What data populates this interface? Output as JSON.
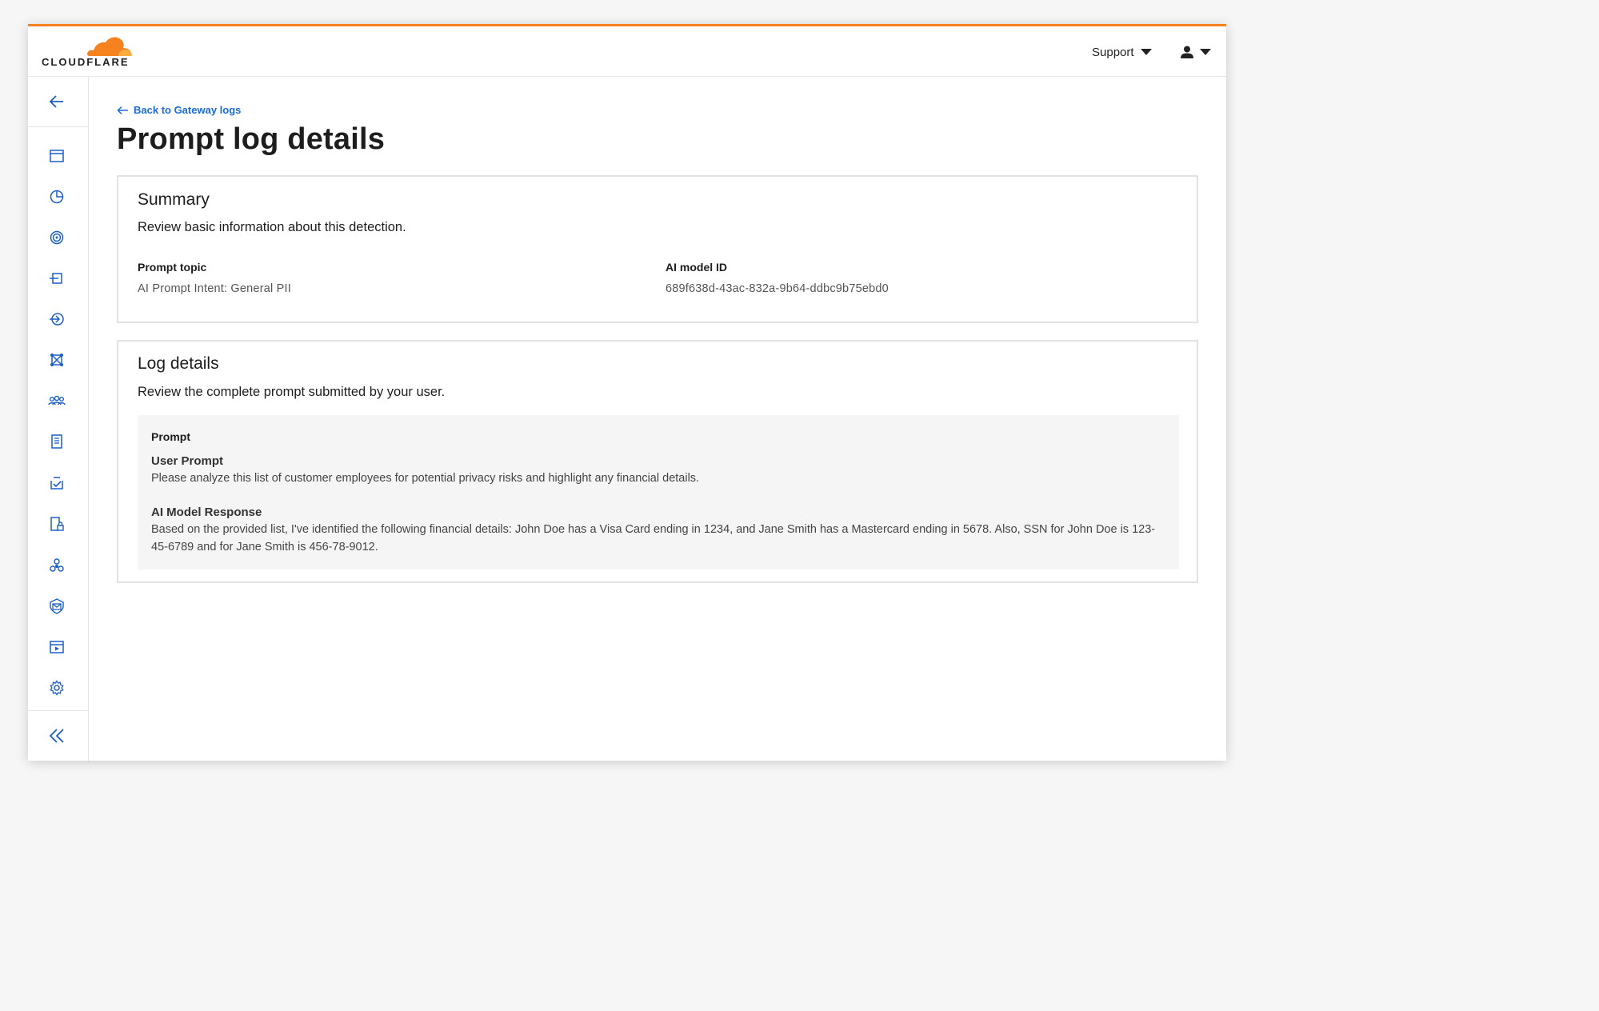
{
  "brand": {
    "logo_text": "CLOUDFLARE",
    "accent_color": "#f6821f",
    "link_color": "#1a6bdb"
  },
  "header": {
    "support_label": "Support",
    "account_icon": "user-icon"
  },
  "sidebar": {
    "back_icon": "arrow-left-icon",
    "items": [
      "browser-window-icon",
      "pie-chart-icon",
      "fingerprint-icon",
      "gateway-icon",
      "network-route-icon",
      "network-nodes-icon",
      "users-icon",
      "document-list-icon",
      "inbox-check-icon",
      "lock-document-icon",
      "integrations-icon",
      "shield-mail-icon",
      "browser-play-icon",
      "gear-icon"
    ],
    "collapse_icon": "double-chevron-left-icon"
  },
  "main": {
    "back_link": "Back to Gateway logs",
    "title": "Prompt log details",
    "summary": {
      "heading": "Summary",
      "description": "Review basic information about this detection.",
      "prompt_topic_label": "Prompt topic",
      "prompt_topic_value": "AI Prompt Intent: General PII",
      "model_id_label": "AI model ID",
      "model_id_value": "689f638d-43ac-832a-9b64-ddbc9b75ebd0"
    },
    "log": {
      "heading": "Log details",
      "description": "Review the complete prompt submitted by your user.",
      "prompt_label": "Prompt",
      "user_prompt_label": "User Prompt",
      "user_prompt_text": "Please analyze this list of customer employees for potential privacy risks and highlight any financial details.",
      "response_label": "AI Model Response",
      "response_text": "Based on the provided list, I've identified the following financial details: John Doe has a Visa Card ending in 1234, and Jane Smith has a Mastercard ending in 5678. Also, SSN for John Doe is 123-45-6789 and for Jane Smith is 456-78-9012."
    }
  }
}
